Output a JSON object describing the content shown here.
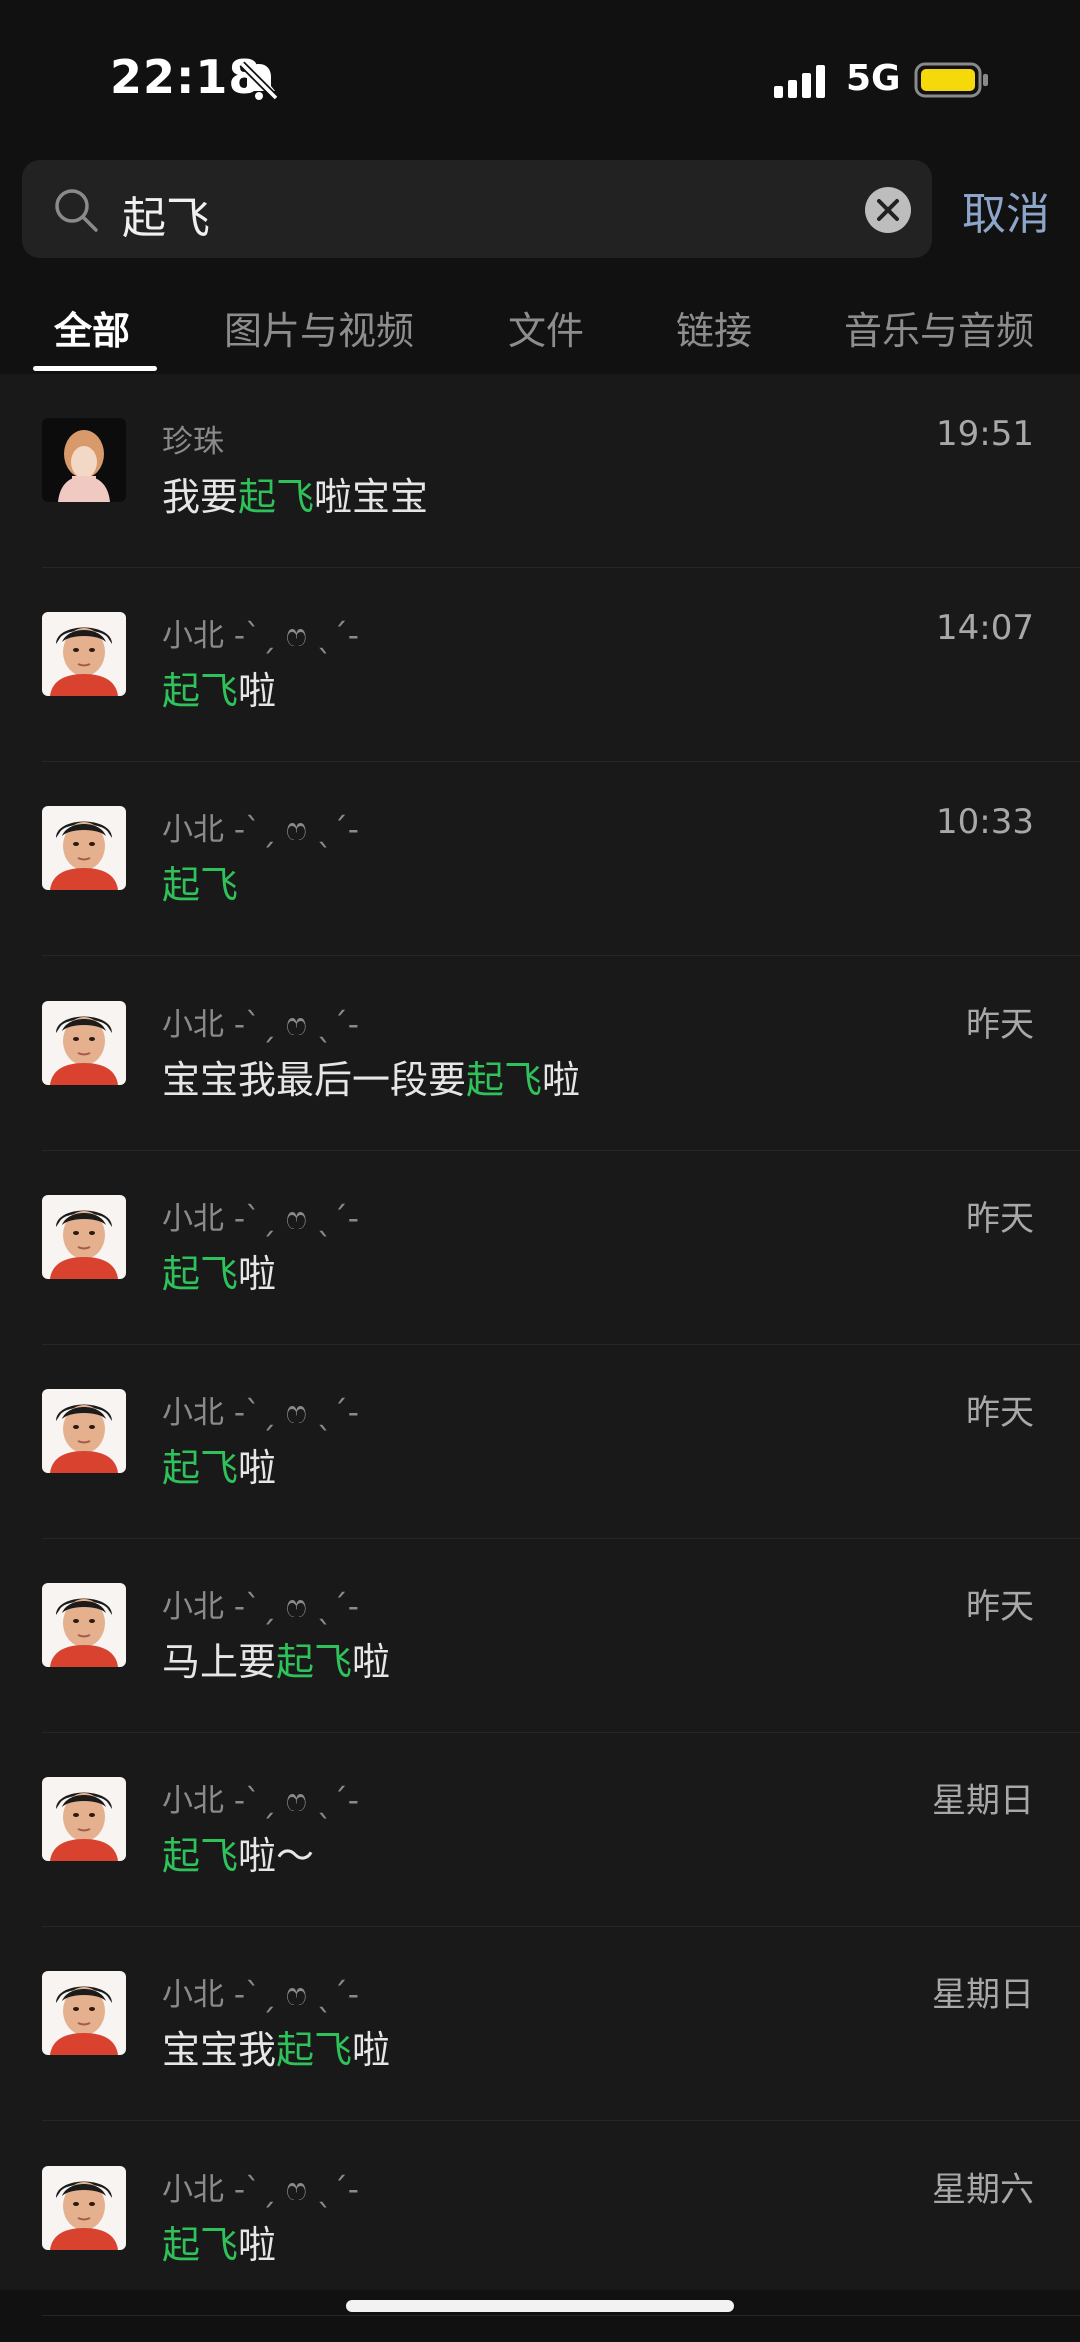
{
  "status_bar": {
    "time": "22:18",
    "network": "5G",
    "battery_color": "#f5d90a"
  },
  "search": {
    "query": "起飞",
    "cancel_label": "取消"
  },
  "tabs": [
    {
      "label": "全部",
      "active": true
    },
    {
      "label": "图片与视频",
      "active": false
    },
    {
      "label": "文件",
      "active": false
    },
    {
      "label": "链接",
      "active": false
    },
    {
      "label": "音乐与音频",
      "active": false
    }
  ],
  "results": [
    {
      "sender": "珍珠",
      "time": "19:51",
      "avatar": "avatar-girl",
      "pre": "我要",
      "hl": "起飞",
      "post": "啦宝宝"
    },
    {
      "sender": "小北 -ˋˏ ෆ ˎˊ-",
      "time": "14:07",
      "avatar": "avatar-boy",
      "pre": "",
      "hl": "起飞",
      "post": "啦"
    },
    {
      "sender": "小北 -ˋˏ ෆ ˎˊ-",
      "time": "10:33",
      "avatar": "avatar-boy",
      "pre": "",
      "hl": "起飞",
      "post": ""
    },
    {
      "sender": "小北 -ˋˏ ෆ ˎˊ-",
      "time": "昨天",
      "avatar": "avatar-boy",
      "pre": "宝宝我最后一段要",
      "hl": "起飞",
      "post": "啦"
    },
    {
      "sender": "小北 -ˋˏ ෆ ˎˊ-",
      "time": "昨天",
      "avatar": "avatar-boy",
      "pre": "",
      "hl": "起飞",
      "post": "啦"
    },
    {
      "sender": "小北 -ˋˏ ෆ ˎˊ-",
      "time": "昨天",
      "avatar": "avatar-boy",
      "pre": "",
      "hl": "起飞",
      "post": "啦"
    },
    {
      "sender": "小北 -ˋˏ ෆ ˎˊ-",
      "time": "昨天",
      "avatar": "avatar-boy",
      "pre": "马上要",
      "hl": "起飞",
      "post": "啦"
    },
    {
      "sender": "小北 -ˋˏ ෆ ˎˊ-",
      "time": "星期日",
      "avatar": "avatar-boy",
      "pre": "",
      "hl": "起飞",
      "post": "啦～"
    },
    {
      "sender": "小北 -ˋˏ ෆ ˎˊ-",
      "time": "星期日",
      "avatar": "avatar-boy",
      "pre": "宝宝我",
      "hl": "起飞",
      "post": "啦"
    },
    {
      "sender": "小北 -ˋˏ ෆ ˎˊ-",
      "time": "星期六",
      "avatar": "avatar-boy",
      "pre": "",
      "hl": "起飞",
      "post": "啦"
    }
  ]
}
